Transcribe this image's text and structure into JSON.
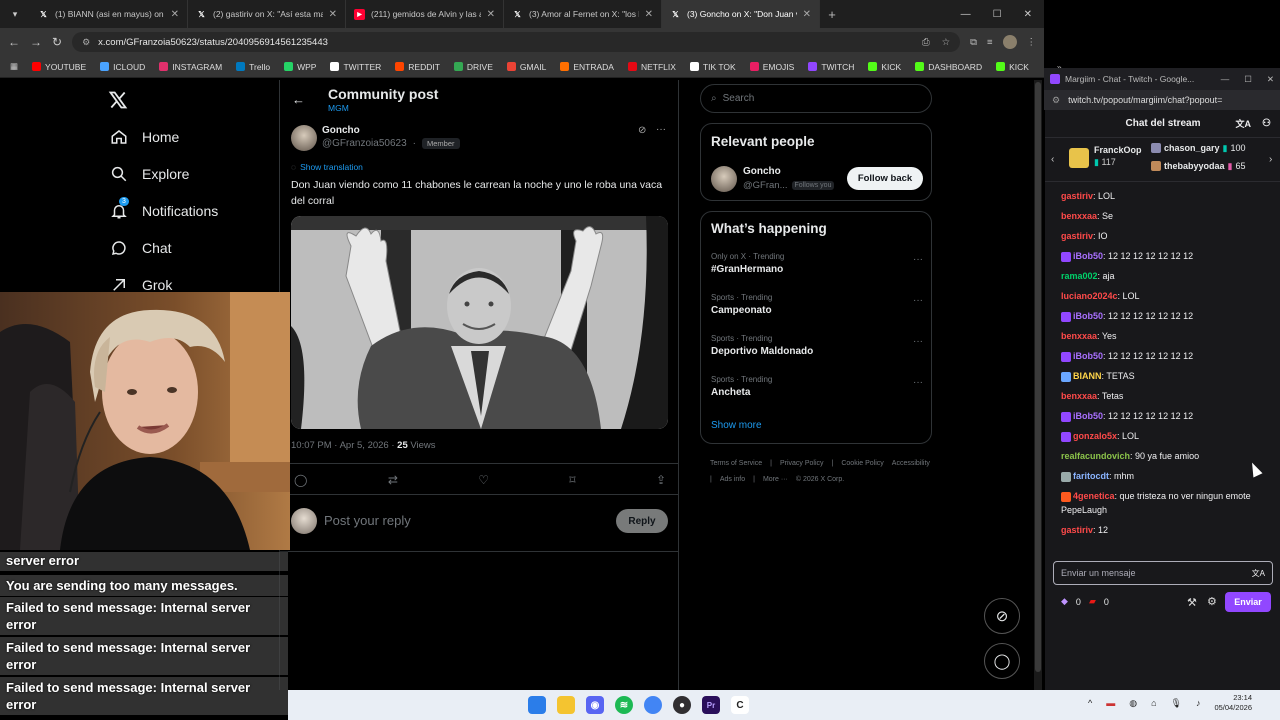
{
  "browser": {
    "tabs": [
      {
        "label": "(1) BIANN (asi en mayus) on X:",
        "icon": "x-favicon"
      },
      {
        "label": "(2) gastiriv on X: \"Así esta mate",
        "icon": "x-favicon"
      },
      {
        "label": "(211) gemidos de Alvin y las ar",
        "icon": "youtube-favicon"
      },
      {
        "label": "(3) Amor al Fernet on X: \"los hu",
        "icon": "x-favicon"
      },
      {
        "label": "(3) Goncho on X: \"Don Juan vie",
        "icon": "x-favicon"
      }
    ],
    "new_tab": "+",
    "url": "x.com/GFranzoia50623/status/2040956914561235443",
    "bookmarks": [
      "YOUTUBE",
      "ICLOUD",
      "INSTAGRAM",
      "Trello",
      "WPP",
      "TWITTER",
      "REDDIT",
      "DRIVE",
      "GMAIL",
      "ENTRADA",
      "NETFLIX",
      "TIK TOK",
      "EMOJIS",
      "TWITCH",
      "KICK",
      "DASHBOARD",
      "KICK"
    ],
    "bookmark_colors": [
      "#ff0000",
      "#4aa3ff",
      "#e1306c",
      "#0079bf",
      "#25d366",
      "#ffffff",
      "#ff4500",
      "#34a853",
      "#ea4335",
      "#ff6f00",
      "#e50914",
      "#ffffff",
      "#e91e63",
      "#9146ff",
      "#53fc18",
      "#53fc18",
      "#53fc18"
    ]
  },
  "x_nav": {
    "items": [
      {
        "label": "Home",
        "icon": "home-icon"
      },
      {
        "label": "Explore",
        "icon": "search-icon"
      },
      {
        "label": "Notifications",
        "icon": "bell-icon",
        "badge": "3"
      },
      {
        "label": "Chat",
        "icon": "chat-icon"
      },
      {
        "label": "Grok",
        "icon": "grok-icon"
      }
    ]
  },
  "post": {
    "header_title": "Community post",
    "header_sub": "MGM",
    "author_name": "Goncho",
    "author_handle": "@GFranzoia50623",
    "member_badge": "Member",
    "show_translation": "Show translation",
    "text": "Don Juan viendo como 11 chabones le carrean la noche y uno le roba una vaca del corral",
    "time": "10:07 PM · Apr 5, 2026 · ",
    "views_count": "25",
    "views_label": " Views",
    "reply_placeholder": "Post your reply",
    "reply_button": "Reply"
  },
  "right": {
    "search_placeholder": "Search",
    "relevant_title": "Relevant people",
    "person_name": "Goncho",
    "person_handle": "@GFran...",
    "follows_you": "Follows you",
    "follow_back": "Follow back",
    "happening_title": "What’s happening",
    "trends": [
      {
        "meta": "Only on X · Trending",
        "name": "#GranHermano"
      },
      {
        "meta": "Sports · Trending",
        "name": "Campeonato"
      },
      {
        "meta": "Sports · Trending",
        "name": "Deportivo Maldonado"
      },
      {
        "meta": "Sports · Trending",
        "name": "Ancheta"
      }
    ],
    "show_more": "Show more",
    "footer": [
      "Terms of Service",
      "Privacy Policy",
      "Cookie Policy",
      "Accessibility",
      "Ads info",
      "More ···",
      "© 2026 X Corp."
    ]
  },
  "twitch": {
    "window_title": "Margiim - Chat - Twitch - Google...",
    "url": "twitch.tv/popout/margiim/chat?popout=",
    "chat_title": "Chat del stream",
    "gifter_name": "FranckOop",
    "gifter_count": "117",
    "top1_name": "chason_gary",
    "top1_count": "100",
    "top2_name": "thebabyyodaa",
    "top2_count": "65",
    "messages": [
      {
        "user": "gastiriv",
        "color": "#ff4a4a",
        "text": ": LOL",
        "badge": ""
      },
      {
        "user": "benxxaa",
        "color": "#ff4a4a",
        "text": ": Se",
        "badge": ""
      },
      {
        "user": "gastiriv",
        "color": "#ff4a4a",
        "text": ": IO",
        "badge": ""
      },
      {
        "user": "iBob50",
        "color": "#a970ff",
        "text": ": 12 12 12 12 12 12 12",
        "badge": "#9147ff"
      },
      {
        "user": "rama002",
        "color": "#00d26a",
        "text": ": aja",
        "badge": ""
      },
      {
        "user": "luciano2024c",
        "color": "#ff4a4a",
        "text": ": LOL",
        "badge": ""
      },
      {
        "user": "iBob50",
        "color": "#a970ff",
        "text": ": 12 12 12 12 12 12 12",
        "badge": "#9147ff"
      },
      {
        "user": "benxxaa",
        "color": "#ff4a4a",
        "text": ": Yes",
        "badge": ""
      },
      {
        "user": "iBob50",
        "color": "#a970ff",
        "text": ": 12 12 12 12 12 12 12",
        "badge": "#9147ff"
      },
      {
        "user": "BIANN",
        "color": "#ffd54a",
        "text": ": TETAS",
        "badge": "#6aa6ff"
      },
      {
        "user": "benxxaa",
        "color": "#ff4a4a",
        "text": ": Tetas",
        "badge": ""
      },
      {
        "user": "iBob50",
        "color": "#a970ff",
        "text": ": 12 12 12 12 12 12 12",
        "badge": "#9147ff"
      },
      {
        "user": "gonzalo5x",
        "color": "#ff4a4a",
        "text": ": LOL",
        "badge": "#9147ff"
      },
      {
        "user": "realfacundovich",
        "color": "#8bc34a",
        "text": ": 90 ya fue amioo",
        "badge": ""
      },
      {
        "user": "faritocdt",
        "color": "#8ab4ff",
        "text": ": mhm",
        "badge": "#9aa"
      },
      {
        "user": "4genetica",
        "color": "#ff4a4a",
        "text": ": que tristeza no ver ningun emote PepeLaugh",
        "badge": "#ff5a1f"
      },
      {
        "user": "gastiriv",
        "color": "#ff4a4a",
        "text": ": 12",
        "badge": ""
      }
    ],
    "input_placeholder": "Enviar un mensaje",
    "points_a": "0",
    "points_b": "0",
    "send_button": "Enviar"
  },
  "overlay": {
    "errors": [
      "server error",
      "You are sending too many messages.",
      "Failed to send message: Internal server error",
      "Failed to send message: Internal server error",
      "Failed to send message: Internal server error"
    ]
  },
  "taskbar": {
    "time": "23:14",
    "date": "05/04/2026"
  }
}
